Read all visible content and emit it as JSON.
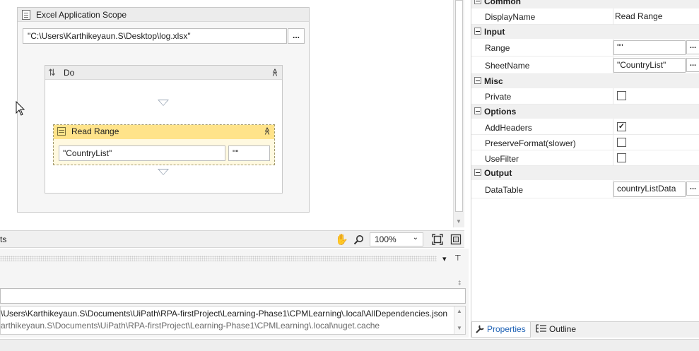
{
  "designer": {
    "scope": {
      "title": "Excel Application Scope",
      "path_value": "\"C:\\Users\\Karthikeyaun.S\\Desktop\\log.xlsx\"",
      "browse_label": "..."
    },
    "do": {
      "title": "Do",
      "collapse_glyph": "≪"
    },
    "read_range": {
      "title": "Read Range",
      "sheet_value": "\"CountryList\"",
      "range_value": "\"\"",
      "collapse_glyph": "≪"
    }
  },
  "status": {
    "left_text": "ts",
    "zoom": "100%",
    "zoom_chevron": "⌄"
  },
  "output": {
    "lines": [
      "\\Users\\Karthikeyaun.S\\Documents\\UiPath\\RPA-firstProject\\Learning-Phase1\\CPMLearning\\.local\\AllDependencies.json",
      "arthikeyaun.S\\Documents\\UiPath\\RPA-firstProject\\Learning-Phase1\\CPMLearning\\.local\\nuget.cache"
    ],
    "pin_glyph": "⊥",
    "dropdown_glyph": "▾"
  },
  "properties": {
    "categories": {
      "common": "Common",
      "input": "Input",
      "misc": "Misc",
      "options": "Options",
      "output": "Output"
    },
    "display_name": {
      "name": "DisplayName",
      "value": "Read Range"
    },
    "range": {
      "name": "Range",
      "value": "\"\""
    },
    "sheet_name": {
      "name": "SheetName",
      "value": "\"CountryList\""
    },
    "private": {
      "name": "Private",
      "checked": ""
    },
    "add_headers": {
      "name": "AddHeaders",
      "checked": "✓"
    },
    "preserve_format": {
      "name": "PreserveFormat(slower)",
      "checked": ""
    },
    "use_filter": {
      "name": "UseFilter",
      "checked": ""
    },
    "data_table": {
      "name": "DataTable",
      "value": "countryListData"
    },
    "dots": "...",
    "tabs": {
      "properties": "Properties",
      "outline": "Outline"
    }
  },
  "icons": [
    "excel-scope-icon",
    "sequence-icon",
    "read-range-icon",
    "hand-pan-icon",
    "search-zoom-icon",
    "fit-screen-icon",
    "overview-icon",
    "wrench-icon",
    "outline-icon",
    "pin-icon"
  ]
}
